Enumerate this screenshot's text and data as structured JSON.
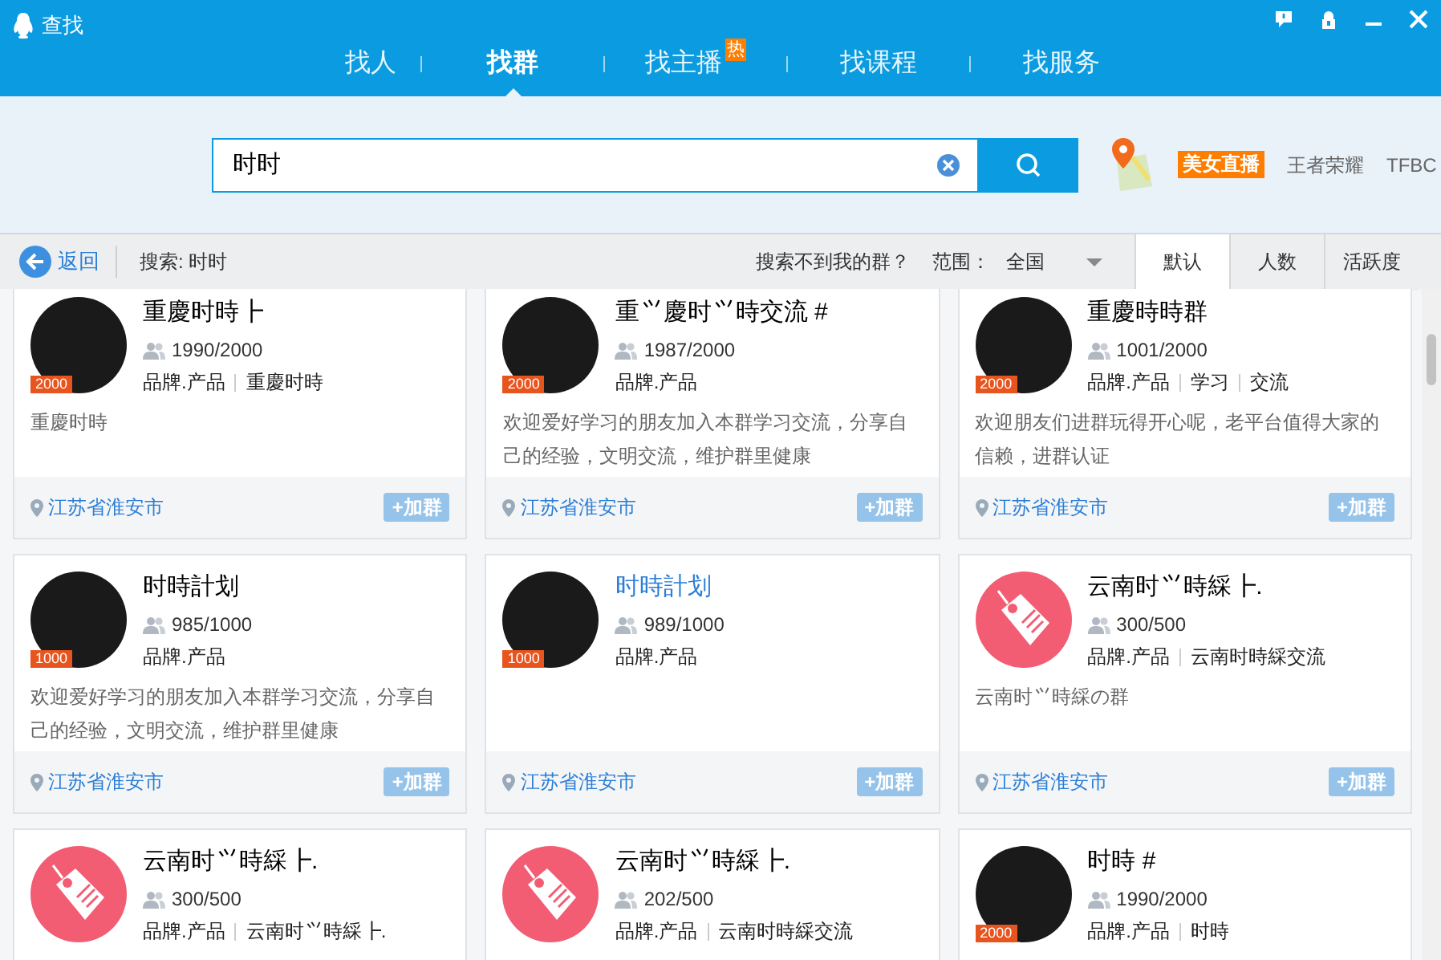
{
  "window": {
    "title": "查找"
  },
  "tabs": [
    {
      "label": "找人",
      "selected": false
    },
    {
      "label": "找群",
      "selected": true
    },
    {
      "label": "找主播",
      "selected": false,
      "badge": "热"
    },
    {
      "label": "找课程",
      "selected": false
    },
    {
      "label": "找服务",
      "selected": false
    }
  ],
  "search": {
    "value": "时时"
  },
  "hot_links": [
    {
      "label": "美女直播",
      "kind": "tag"
    },
    {
      "label": "王者荣耀",
      "kind": "plain"
    },
    {
      "label": "TFBC",
      "kind": "plain"
    }
  ],
  "toolbar": {
    "back": "返回",
    "query": "搜索: 时时",
    "hint": "搜索不到我的群？",
    "range_label": "范围：",
    "range_value": "全国",
    "sort_tabs": [
      {
        "label": "默认",
        "selected": true
      },
      {
        "label": "人数",
        "selected": false
      },
      {
        "label": "活跃度",
        "selected": false
      }
    ]
  },
  "groups": [
    {
      "name": "重慶时時┣",
      "highlighted": false,
      "kind": "photo",
      "badge": "2000",
      "members": "1990/2000",
      "tags": [
        "品牌.产品",
        "重慶时時"
      ],
      "description": "重慶时時",
      "location": "江苏省淮安市",
      "join": "+加群"
    },
    {
      "name": "重⺍慶时⺍時交流 #",
      "highlighted": false,
      "kind": "photo",
      "badge": "2000",
      "members": "1987/2000",
      "tags": [
        "品牌.产品"
      ],
      "description": "欢迎爱好学习的朋友加入本群学习交流，分享自己的经验，文明交流，维护群里健康",
      "location": "江苏省淮安市",
      "join": "+加群"
    },
    {
      "name": "重慶時時群",
      "highlighted": false,
      "kind": "photo",
      "badge": "2000",
      "members": "1001/2000",
      "tags": [
        "品牌.产品",
        "学习",
        "交流"
      ],
      "description": "欢迎朋友们进群玩得开心呢，老平台值得大家的信赖，进群认证",
      "location": "江苏省淮安市",
      "join": "+加群"
    },
    {
      "name": "时時計划",
      "highlighted": false,
      "kind": "photo",
      "badge": "1000",
      "members": "985/1000",
      "tags": [
        "品牌.产品"
      ],
      "description": "欢迎爱好学习的朋友加入本群学习交流，分享自己的经验，文明交流，维护群里健康",
      "location": "江苏省淮安市",
      "join": "+加群"
    },
    {
      "name": "时時計划",
      "highlighted": true,
      "kind": "photo",
      "badge": "1000",
      "members": "989/1000",
      "tags": [
        "品牌.产品"
      ],
      "location": "江苏省淮安市",
      "join": "+加群"
    },
    {
      "name": "云南时⺍時綵┣.",
      "highlighted": false,
      "kind": "tag",
      "members": "300/500",
      "tags": [
        "品牌.产品",
        "云南时時綵交流"
      ],
      "description": "云南时⺍時綵の群",
      "location": "江苏省淮安市",
      "join": "+加群"
    },
    {
      "name": "云南时⺍時綵┣.",
      "highlighted": false,
      "kind": "tag",
      "members": "300/500",
      "tags": [
        "品牌.产品",
        "云南时⺍時綵┣."
      ]
    },
    {
      "name": "云南时⺍時綵┣.",
      "highlighted": false,
      "kind": "tag",
      "members": "202/500",
      "tags": [
        "品牌.产品",
        "云南时時綵交流"
      ]
    },
    {
      "name": "时時 #",
      "highlighted": false,
      "kind": "photo",
      "badge": "2000",
      "members": "1990/2000",
      "tags": [
        "品牌.产品",
        "时時"
      ]
    }
  ]
}
